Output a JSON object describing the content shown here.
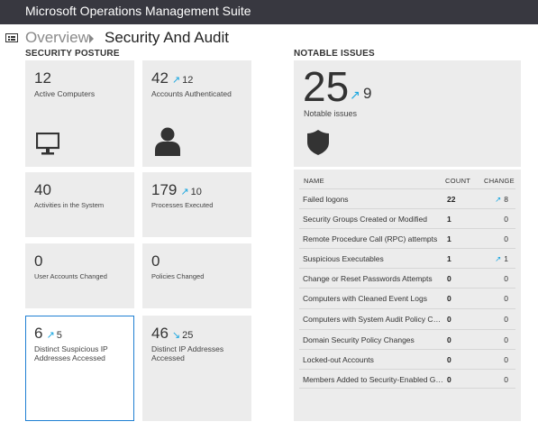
{
  "app": {
    "title": "Microsoft Operations Management Suite"
  },
  "breadcrumb": {
    "overview": "Overview",
    "page": "Security And Audit"
  },
  "posture": {
    "title": "SECURITY POSTURE",
    "tiles": [
      {
        "value": "12",
        "delta": "",
        "delta_dir": "",
        "label": "Active Computers",
        "icon": "monitor-icon"
      },
      {
        "value": "42",
        "delta": "12",
        "delta_dir": "↗",
        "label": "Accounts Authenticated",
        "icon": "person-icon"
      },
      {
        "value": "40",
        "delta": "",
        "delta_dir": "",
        "label": "Activities in the System"
      },
      {
        "value": "179",
        "delta": "10",
        "delta_dir": "↗",
        "label": "Processes Executed"
      },
      {
        "value": "0",
        "delta": "",
        "delta_dir": "",
        "label": "User Accounts Changed"
      },
      {
        "value": "0",
        "delta": "",
        "delta_dir": "",
        "label": "Policies Changed"
      },
      {
        "value": "6",
        "delta": "5",
        "delta_dir": "↗",
        "label": "Distinct Suspicious IP Addresses Accessed"
      },
      {
        "value": "46",
        "delta": "25",
        "delta_dir": "↘",
        "label": "Distinct IP Addresses Accessed"
      }
    ]
  },
  "notable": {
    "title": "NOTABLE ISSUES",
    "value": "25",
    "delta_dir": "↗",
    "delta": "9",
    "label": "Notable issues",
    "icon": "shield-icon",
    "table": {
      "headers": {
        "name": "NAME",
        "count": "COUNT",
        "change": "CHANGE"
      },
      "rows": [
        {
          "name": "Failed logons",
          "count": "22",
          "change": "8",
          "change_dir": "↗"
        },
        {
          "name": "Security Groups Created or Modified",
          "count": "1",
          "change": "0",
          "change_dir": ""
        },
        {
          "name": "Remote Procedure Call (RPC) attempts",
          "count": "1",
          "change": "0",
          "change_dir": ""
        },
        {
          "name": "Suspicious Executables",
          "count": "1",
          "change": "1",
          "change_dir": "↗"
        },
        {
          "name": "Change or Reset Passwords Attempts",
          "count": "0",
          "change": "0",
          "change_dir": ""
        },
        {
          "name": "Computers with Cleaned Event Logs",
          "count": "0",
          "change": "0",
          "change_dir": ""
        },
        {
          "name": "Computers with System Audit Policy Chan...",
          "count": "0",
          "change": "0",
          "change_dir": ""
        },
        {
          "name": "Domain Security Policy Changes",
          "count": "0",
          "change": "0",
          "change_dir": ""
        },
        {
          "name": "Locked-out Accounts",
          "count": "0",
          "change": "0",
          "change_dir": ""
        },
        {
          "name": "Members Added to Security-Enabled Gro...",
          "count": "0",
          "change": "0",
          "change_dir": ""
        }
      ]
    }
  },
  "colors": {
    "topbar": "#383840",
    "accent": "#1ba7e0",
    "selected_border": "#1f7fd2",
    "tile_bg": "#ececec"
  }
}
